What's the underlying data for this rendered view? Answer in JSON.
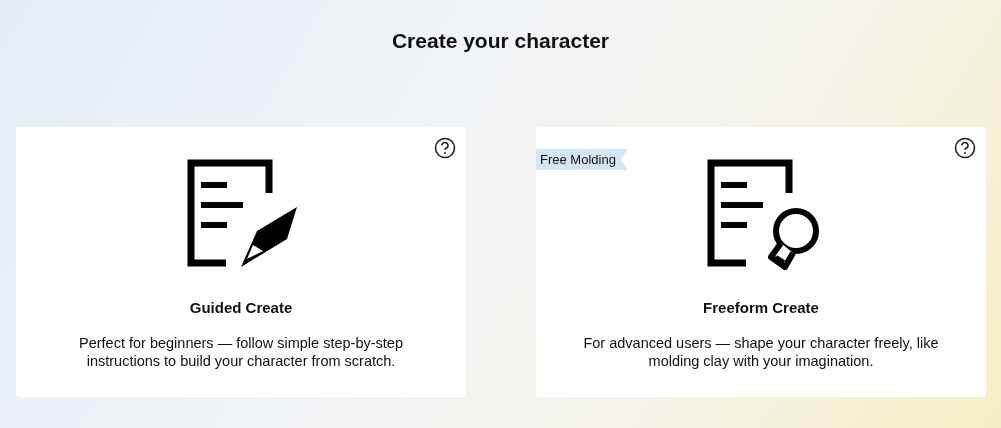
{
  "title": "Create your character",
  "cards": [
    {
      "kind": "pen",
      "name": "Guided Create",
      "description": "Perfect for beginners — follow simple step-by-step instructions to build your character from scratch."
    },
    {
      "kind": "bulb",
      "badge": "Free Molding",
      "name": "Freeform Create",
      "description": "For advanced users — shape your character freely, like molding clay with your imagination."
    }
  ]
}
